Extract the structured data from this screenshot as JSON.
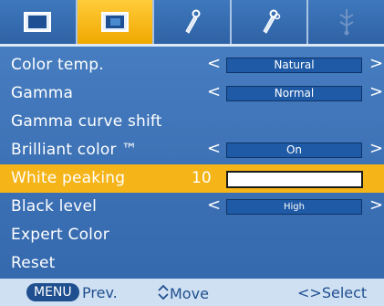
{
  "tabs": [
    {
      "icon": "picture-icon",
      "active": false
    },
    {
      "icon": "picture-advanced-icon",
      "active": true
    },
    {
      "icon": "tools-icon",
      "active": false
    },
    {
      "icon": "settings-tools-icon",
      "active": false
    },
    {
      "icon": "input-icon",
      "active": false
    }
  ],
  "menu": {
    "color_temp": {
      "label": "Color temp.",
      "value": "Natural"
    },
    "gamma": {
      "label": "Gamma",
      "value": "Normal"
    },
    "gamma_curve_shift": {
      "label": "Gamma curve shift"
    },
    "brilliant_color": {
      "label": "Brilliant color ™",
      "value": "On"
    },
    "white_peaking": {
      "label": "White peaking",
      "value": "10",
      "level_fraction": 0.0
    },
    "black_level": {
      "label": "Black level",
      "value": "High"
    },
    "expert_color": {
      "label": "Expert Color"
    },
    "reset": {
      "label": "Reset"
    }
  },
  "arrows": {
    "left": "<",
    "right": ">"
  },
  "footer": {
    "menu_key": "MENU",
    "prev_label": "Prev.",
    "move_label": "Move",
    "select_label": "Select",
    "select_glyph": "<>"
  },
  "colors": {
    "background": "#3c70b4",
    "highlight": "#f5b418",
    "value_box": "#1f5aa6",
    "footer_bg": "#cfe0f2",
    "footer_text": "#1f4f8f"
  }
}
